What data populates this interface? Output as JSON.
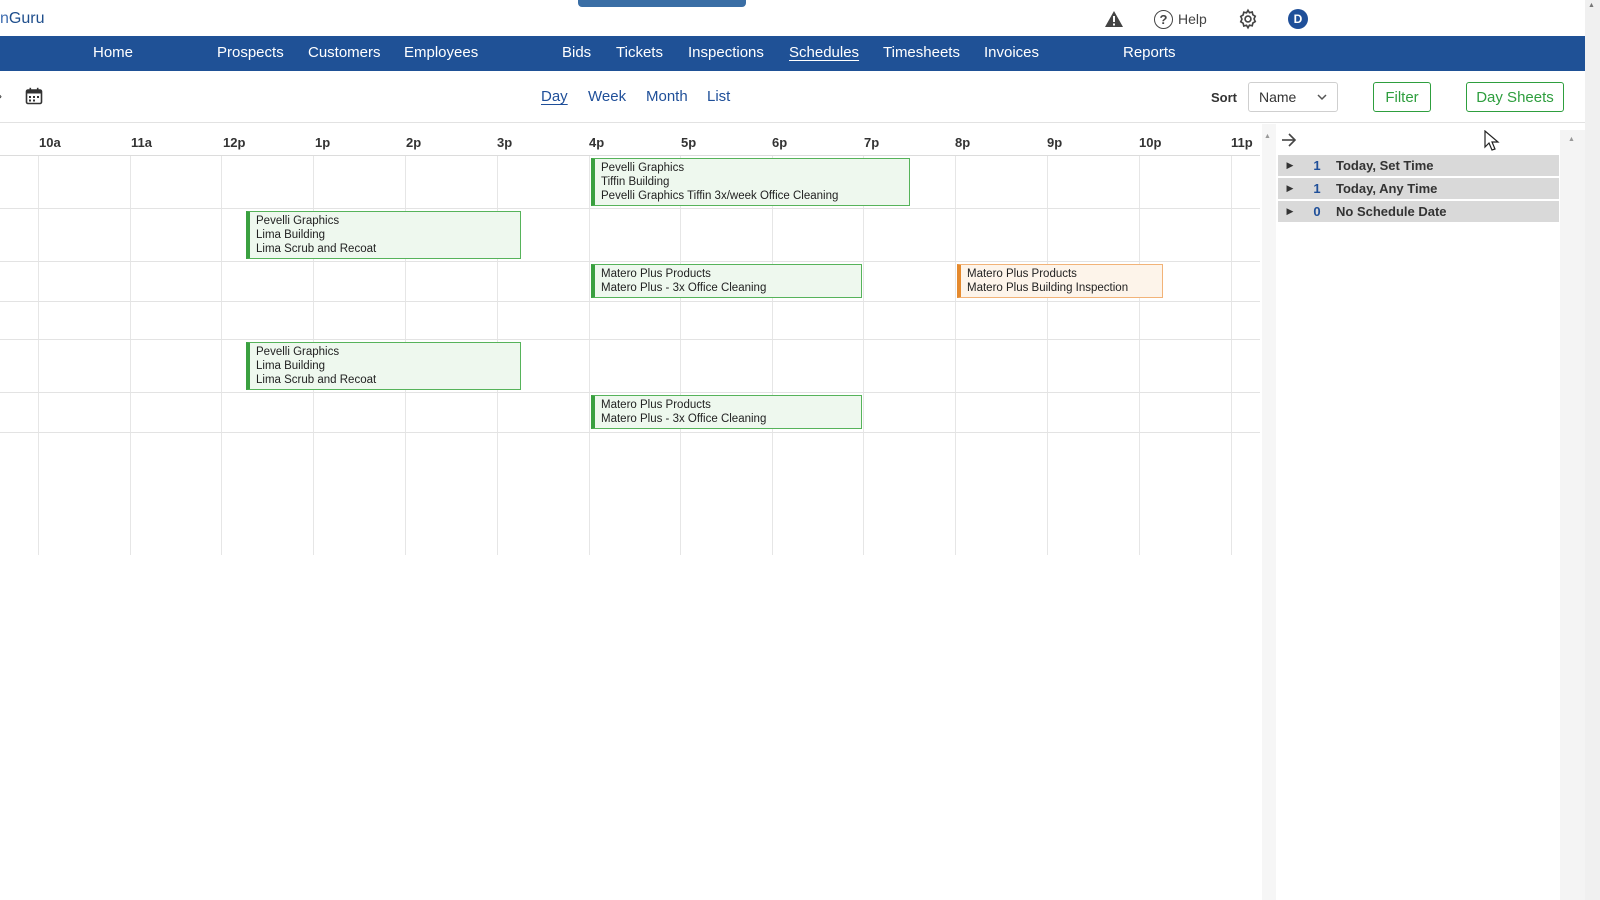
{
  "app": {
    "logo_partial": "n",
    "logo_main": "Guru"
  },
  "top_icons": {
    "warning": "warning-icon",
    "help_label": "Help",
    "help_glyph": "?",
    "settings": "gear-icon",
    "user_initial": "D"
  },
  "nav": [
    {
      "label": "Home",
      "active": false
    },
    {
      "label": "Prospects",
      "active": false
    },
    {
      "label": "Customers",
      "active": false
    },
    {
      "label": "Employees",
      "active": false
    },
    {
      "label": "Bids",
      "active": false
    },
    {
      "label": "Tickets",
      "active": false
    },
    {
      "label": "Inspections",
      "active": false
    },
    {
      "label": "Schedules",
      "active": true
    },
    {
      "label": "Timesheets",
      "active": false
    },
    {
      "label": "Invoices",
      "active": false
    },
    {
      "label": "Reports",
      "active": false
    }
  ],
  "toolbar": {
    "views": [
      {
        "label": "Day",
        "active": true
      },
      {
        "label": "Week",
        "active": false
      },
      {
        "label": "Month",
        "active": false
      },
      {
        "label": "List",
        "active": false
      }
    ],
    "sort_label": "Sort",
    "sort_value": "Name",
    "filter_label": "Filter",
    "day_sheets_label": "Day Sheets"
  },
  "timeline": {
    "hours": [
      "10a",
      "11a",
      "12p",
      "1p",
      "2p",
      "3p",
      "4p",
      "5p",
      "6p",
      "7p",
      "8p",
      "9p",
      "10p",
      "11p"
    ],
    "events": [
      {
        "lines": [
          "Pevelli Graphics",
          "Tiffin Building",
          "Pevelli Graphics Tiffin 3x/week Office Cleaning"
        ],
        "color": "green"
      },
      {
        "lines": [
          "Pevelli Graphics",
          "Lima Building",
          "Lima Scrub and Recoat"
        ],
        "color": "green"
      },
      {
        "lines": [
          "Matero Plus Products",
          "Matero Plus - 3x Office Cleaning"
        ],
        "color": "green"
      },
      {
        "lines": [
          "Matero Plus Products",
          "Matero Plus Building Inspection"
        ],
        "color": "orange"
      },
      {
        "lines": [
          "Pevelli Graphics",
          "Lima Building",
          "Lima Scrub and Recoat"
        ],
        "color": "green"
      },
      {
        "lines": [
          "Matero Plus Products",
          "Matero Plus - 3x Office Cleaning"
        ],
        "color": "green"
      }
    ]
  },
  "side_panel": {
    "groups": [
      {
        "count": "1",
        "label": "Today, Set Time"
      },
      {
        "count": "1",
        "label": "Today, Any Time"
      },
      {
        "count": "0",
        "label": "No Schedule Date"
      }
    ]
  }
}
